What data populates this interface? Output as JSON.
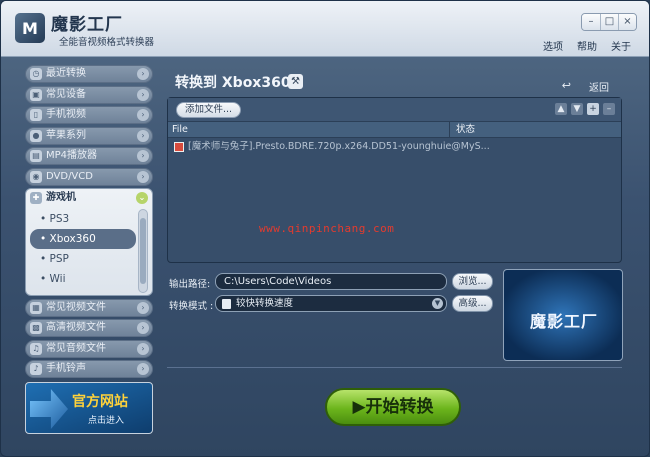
{
  "app": {
    "title": "魔影工厂",
    "subtitle": "全能音视频格式转换器",
    "logo_text": "M",
    "win_minimize": "–",
    "win_restore": "□",
    "win_close": "×",
    "menu": [
      "选项",
      "帮助",
      "关于"
    ]
  },
  "sidebar": {
    "items_top": [
      {
        "label": "最近转换",
        "icon": "clock-icon",
        "glyph": "◷"
      },
      {
        "label": "常见设备",
        "icon": "device-icon",
        "glyph": "▣"
      },
      {
        "label": "手机视频",
        "icon": "phone-icon",
        "glyph": "▯"
      },
      {
        "label": "苹果系列",
        "icon": "apple-icon",
        "glyph": "●"
      },
      {
        "label": "MP4播放器",
        "icon": "player-icon",
        "glyph": "▤"
      },
      {
        "label": "DVD/VCD",
        "icon": "disc-icon",
        "glyph": "◉"
      }
    ],
    "game": {
      "label": "游戏机",
      "icon_glyph": "✚",
      "options": [
        "PS3",
        "Xbox360",
        "PSP",
        "Wii"
      ],
      "selected": "Xbox360"
    },
    "items_bottom": [
      {
        "label": "常见视频文件",
        "icon": "video-file-icon",
        "glyph": "▦"
      },
      {
        "label": "高清视频文件",
        "icon": "hd-file-icon",
        "glyph": "▩"
      },
      {
        "label": "常见音频文件",
        "icon": "music-icon",
        "glyph": "♫"
      },
      {
        "label": "手机铃声",
        "icon": "ringtone-icon",
        "glyph": "♪"
      }
    ],
    "chevron": "›",
    "banner_title": "官方网站",
    "banner_sub": "点击进入"
  },
  "main": {
    "title": "转换到 Xbox360",
    "settings_glyph": "⚒",
    "back_label": "返回",
    "back_glyph": "↩",
    "add_file_label": "添加文件...",
    "toolbar_glyphs": [
      "▲",
      "▼",
      "+",
      "–"
    ],
    "columns": {
      "file": "File",
      "status": "状态"
    },
    "files": [
      {
        "name": "[魔术师与兔子].Presto.BDRE.720p.x264.DD51-younghuie@MyS...",
        "status": ""
      }
    ],
    "watermark": "www.qinpinchang.com",
    "output_label": "输出路径:",
    "output_path": "C:\\Users\\Code\\Videos",
    "browse_label": "浏览...",
    "mode_label": "转换模式 :",
    "mode_value": "较快转换速度",
    "advanced_label": "高级...",
    "preview_logo": "魔影工厂",
    "start_label": "▶开始转换"
  }
}
